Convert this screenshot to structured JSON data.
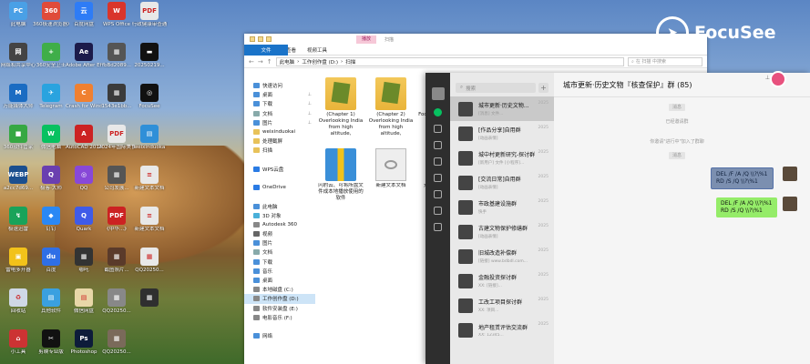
{
  "desktop": {
    "icons": [
      {
        "label": "此电脑",
        "color": "#4aa0e6",
        "glyph": "PC"
      },
      {
        "label": "360极速浏览器X",
        "color": "#e04b3a",
        "glyph": "360"
      },
      {
        "label": "百度网盘",
        "color": "#2e7cf6",
        "glyph": "云"
      },
      {
        "label": "WPS Office",
        "color": "#d9352b",
        "glyph": "W"
      },
      {
        "label": "行政健康审查通",
        "color": "#e8e8e8",
        "glyph": "PDF"
      },
      {
        "label": "网络和共享中心",
        "color": "#444",
        "glyph": "网"
      },
      {
        "label": "360安全卫士",
        "color": "#3fae49",
        "glyph": "+"
      },
      {
        "label": "Adobe After Effects 2025",
        "color": "#1c1b4a",
        "glyph": "Ae"
      },
      {
        "label": "fbBd2089...",
        "color": "#555",
        "glyph": "▦"
      },
      {
        "label": "20250219...",
        "color": "#111",
        "glyph": "▬"
      },
      {
        "label": "万能媒体大师",
        "color": "#1b6cc2",
        "glyph": "M"
      },
      {
        "label": "Telegram",
        "color": "#2aa3df",
        "glyph": "✈"
      },
      {
        "label": "Crash for Windows",
        "color": "#f08030",
        "glyph": "C"
      },
      {
        "label": "1543e1bb...",
        "color": "#3b3b3b",
        "glyph": "▦"
      },
      {
        "label": "FocuSee",
        "color": "#111",
        "glyph": "◎"
      },
      {
        "label": "360软件管家",
        "color": "#36a843",
        "glyph": "■"
      },
      {
        "label": "微信电脑",
        "color": "#07c160",
        "glyph": "W"
      },
      {
        "label": "AutoCAD 2014 - 简体",
        "color": "#c22",
        "glyph": "A"
      },
      {
        "label": "2024年国际美食",
        "color": "#e8e8e8",
        "glyph": "PDF"
      },
      {
        "label": "weixinduoka",
        "color": "#2f8fd8",
        "glyph": "▤"
      },
      {
        "label": "a2cc7d69...",
        "color": "#1b4f8f",
        "glyph": "WEBP"
      },
      {
        "label": "极客·大师",
        "color": "#6a3fb0",
        "glyph": "Q"
      },
      {
        "label": "QQ",
        "color": "#8848d8",
        "glyph": "◎"
      },
      {
        "label": "公司发展...",
        "color": "#555",
        "glyph": "▦"
      },
      {
        "label": "新建文本文档",
        "color": "#e8e8e8",
        "glyph": "≡"
      },
      {
        "label": "极速迅雷",
        "color": "#19a35a",
        "glyph": "↯"
      },
      {
        "label": "钉钉",
        "color": "#2a88f5",
        "glyph": "◆"
      },
      {
        "label": "Quark",
        "color": "#3f5be8",
        "glyph": "Q"
      },
      {
        "label": "《中华...》",
        "color": "#c22",
        "glyph": "PDF"
      },
      {
        "label": "新建文本文档",
        "color": "#e8e8e8",
        "glyph": "≡"
      },
      {
        "label": "雷电多开器",
        "color": "#f2c21a",
        "glyph": "▣"
      },
      {
        "label": "百度",
        "color": "#2f6fe6",
        "glyph": "du"
      },
      {
        "label": "哪吒",
        "color": "#333",
        "glyph": "▦"
      },
      {
        "label": "截图照片...",
        "color": "#5a3a2a",
        "glyph": "▦"
      },
      {
        "label": "QQ20250...",
        "color": "#e8e8e8",
        "glyph": "▦"
      },
      {
        "label": "回收站",
        "color": "#cfd8e6",
        "glyph": "♻"
      },
      {
        "label": "其他软件",
        "color": "#3aa0e0",
        "glyph": "▤"
      },
      {
        "label": "微信网盘",
        "color": "#e8d7a8",
        "glyph": "▤"
      },
      {
        "label": "QQ20250...",
        "color": "#888",
        "glyph": "▦"
      },
      {
        "label": "",
        "color": "#2f2f2f",
        "glyph": "▦"
      },
      {
        "label": "小工具",
        "color": "#c33",
        "glyph": "⌂"
      },
      {
        "label": "剪映专业版",
        "color": "#111",
        "glyph": "✂"
      },
      {
        "label": "Photoshop",
        "color": "#0d1c3a",
        "glyph": "Ps"
      },
      {
        "label": "QQ20250...",
        "color": "#7a6a5a",
        "glyph": "▦"
      }
    ]
  },
  "explorer": {
    "ribbon": {
      "file": "文件",
      "home": "主页",
      "share": "共享",
      "view": "查看",
      "manage": "视频工具"
    },
    "title_tab": "播放",
    "title_text": "扫描",
    "path": [
      "此电脑",
      "工作创作盘 (D:)",
      "扫描"
    ],
    "search_placeholder": "在 扫描 中搜索",
    "nav": [
      {
        "label": "快速访问",
        "color": "#4a90d9",
        "pin": ""
      },
      {
        "label": "桌面",
        "color": "#4a90d9",
        "pin": "📌"
      },
      {
        "label": "下载",
        "color": "#4a90d9",
        "pin": "📌"
      },
      {
        "label": "文档",
        "color": "#8aa",
        "pin": "📌"
      },
      {
        "label": "图片",
        "color": "#4a90d9",
        "pin": "📌"
      },
      {
        "label": "weixinduokai",
        "color": "#e8c25a",
        "pin": ""
      },
      {
        "label": "处理截屏",
        "color": "#e8c25a",
        "pin": ""
      },
      {
        "label": "扫描",
        "color": "#e8c25a",
        "pin": ""
      },
      {
        "label": "",
        "color": "transparent",
        "pin": ""
      },
      {
        "label": "WPS云盘",
        "color": "#2a7be4",
        "pin": ""
      },
      {
        "label": "",
        "color": "transparent",
        "pin": ""
      },
      {
        "label": "OneDrive",
        "color": "#2a7be4",
        "pin": ""
      },
      {
        "label": "",
        "color": "transparent",
        "pin": ""
      },
      {
        "label": "此电脑",
        "color": "#4a90d9",
        "pin": ""
      },
      {
        "label": "3D 对象",
        "color": "#4ab0d9",
        "pin": ""
      },
      {
        "label": "Autodesk 360",
        "color": "#888",
        "pin": ""
      },
      {
        "label": "视频",
        "color": "#666",
        "pin": ""
      },
      {
        "label": "图片",
        "color": "#4a90d9",
        "pin": ""
      },
      {
        "label": "文档",
        "color": "#8aa",
        "pin": ""
      },
      {
        "label": "下载",
        "color": "#4a90d9",
        "pin": ""
      },
      {
        "label": "音乐",
        "color": "#4a90d9",
        "pin": ""
      },
      {
        "label": "桌面",
        "color": "#4a90d9",
        "pin": ""
      },
      {
        "label": "本地磁盘 (C:)",
        "color": "#888",
        "pin": ""
      },
      {
        "label": "工作创作盘 (D:)",
        "color": "#888",
        "pin": ""
      },
      {
        "label": "软件安装盘 (E:)",
        "color": "#888",
        "pin": ""
      },
      {
        "label": "电影音乐 (F:)",
        "color": "#888",
        "pin": ""
      },
      {
        "label": "",
        "color": "transparent",
        "pin": ""
      },
      {
        "label": "网络",
        "color": "#4a90d9",
        "pin": ""
      }
    ],
    "files": [
      {
        "name": "(Chapter 1) Overlooking India from high altitude,",
        "kind": "folder"
      },
      {
        "name": "(Chapter 2) Overlooking India from high altitude,",
        "kind": "folder"
      },
      {
        "name": "FocuSee 2025-11-23-17...",
        "kind": "folder"
      },
      {
        "name": "闪豹云、可将所盘文件成本地播放使用的软件",
        "kind": "zip"
      },
      {
        "name": "新建文本文档",
        "kind": "txt"
      },
      {
        "name": "元气桌面小了...",
        "kind": "zip"
      }
    ]
  },
  "wechat": {
    "search_placeholder": "搜索",
    "chat_title": "城市更新·历史文物『核查保护』群 (85)",
    "conversations": [
      {
        "name": "城市更新·历史文物...",
        "preview": "[消息] 文件...",
        "date": "2025"
      },
      {
        "name": "[作品分享]自用群",
        "preview": "[动画表情]",
        "date": "2025"
      },
      {
        "name": "城中村更新研究-探讨群",
        "preview": "[新用户] 文件 [小程序]...",
        "date": "2025"
      },
      {
        "name": "[交流日常]自用群",
        "preview": "[动画表情]",
        "date": "2025"
      },
      {
        "name": "市政基建设施群",
        "preview": "快手",
        "date": "2025"
      },
      {
        "name": "古建文物保护修缮群",
        "preview": "[动画表情]",
        "date": "2025"
      },
      {
        "name": "旧城改造补偿群",
        "preview": "[链接] www.bdbdl.com...",
        "date": "2025"
      },
      {
        "name": "金融投资探讨群",
        "preview": "XX: [链接]...",
        "date": "2025"
      },
      {
        "name": "工改工项目探讨群",
        "preview": "XX: 项目...",
        "date": "2025"
      },
      {
        "name": "地产租赁评估交流群",
        "preview": "XX: 12345...",
        "date": "2025"
      }
    ],
    "system_msgs": [
      "消息",
      "已经邀请群",
      "你邀请\"进行中\"加入了群聊",
      "消息"
    ],
    "bubbles": [
      {
        "text": "DEL /F /A /Q \\\\?\\%1\nRD /S /Q \\\\?\\%1",
        "style": "blue"
      },
      {
        "text": "DEL /F /A /Q \\\\?\\%1\nRD /S /Q \\\\?\\%1",
        "style": "green"
      }
    ]
  },
  "focusee": {
    "brand": "FocuSee"
  }
}
